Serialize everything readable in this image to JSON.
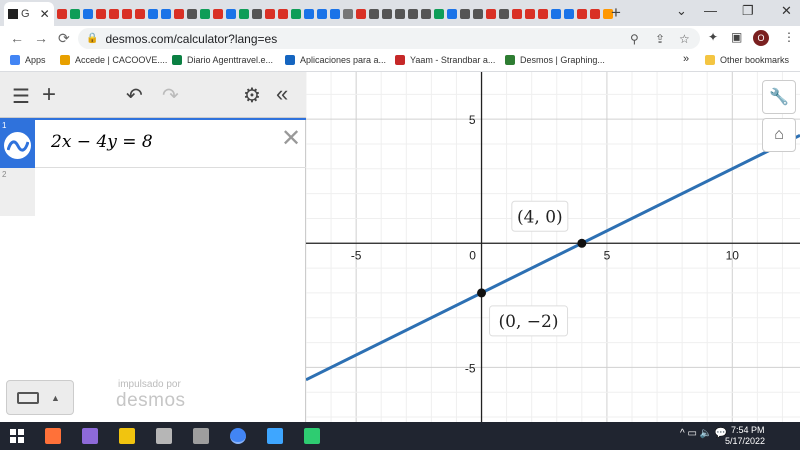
{
  "browser": {
    "active_tab": {
      "label": "G",
      "close": "✕"
    },
    "new_tab": "+",
    "window_controls": {
      "minimize": "—",
      "maximize": "❐",
      "close": "✕",
      "tab_search": "⌄"
    },
    "url": "desmos.com/calculator?lang=es",
    "profile_initial": "O",
    "tab_favicon_colors": [
      "#d93025",
      "#0f9d58",
      "#1a73e8",
      "#d93025",
      "#d93025",
      "#d93025",
      "#d93025",
      "#1a73e8",
      "#1a73e8",
      "#d93025",
      "#555555",
      "#0f9d58",
      "#d93025",
      "#1a73e8",
      "#0f9d58",
      "#555555",
      "#d93025",
      "#d93025",
      "#0f9d58",
      "#1a73e8",
      "#1a73e8",
      "#1a73e8",
      "#777777",
      "#d93025",
      "#555555",
      "#555555",
      "#555555",
      "#555555",
      "#555555",
      "#0f9d58",
      "#1a73e8",
      "#555555",
      "#555555",
      "#d93025",
      "#555555",
      "#d93025",
      "#d93025",
      "#d93025",
      "#1a73e8",
      "#1a73e8",
      "#d93025",
      "#d93025",
      "#ff9800"
    ]
  },
  "bookmarks": {
    "items": [
      {
        "label": "Apps",
        "color": "#4285f4"
      },
      {
        "label": "Accede | CACOOVE....",
        "color": "#e8a000"
      },
      {
        "label": "Diario Agenttravel.e...",
        "color": "#0b8043"
      },
      {
        "label": "Aplicaciones para a...",
        "color": "#1565c0"
      },
      {
        "label": "Yaam - Strandbar a...",
        "color": "#c62828"
      },
      {
        "label": "Desmos | Graphing...",
        "color": "#2e7d32"
      }
    ],
    "more": "»",
    "other": "Other bookmarks"
  },
  "desmos": {
    "expressions": [
      {
        "index": "1",
        "latex": "2x − 4y = 8"
      },
      {
        "index": "2",
        "latex": ""
      }
    ],
    "powered_by": "impulsado por",
    "brand": "desmos",
    "delete_symbol": "✕",
    "graph": {
      "x_ticks": [
        "-5",
        "0",
        "5",
        "10"
      ],
      "y_ticks": [
        "5",
        "-5"
      ],
      "points": [
        {
          "x": 4,
          "y": 0,
          "label": "(4, 0)"
        },
        {
          "x": 0,
          "y": -2,
          "label": "(0, −2)"
        }
      ],
      "line": {
        "slope": 0.5,
        "intercept": -2,
        "color": "#2d70b3"
      },
      "x_range": [
        -7,
        12.7
      ],
      "y_range": [
        -7.2,
        6.9
      ]
    }
  },
  "taskbar": {
    "time": "7:54 PM",
    "date": "5/17/2022",
    "icon_colors": [
      "#ff7139",
      "#8e6ad9",
      "#f1c40f",
      "#b6b6b6",
      "#9e9e9e",
      "#4285f4",
      "#3ea6ff",
      "#2ecc71"
    ]
  }
}
